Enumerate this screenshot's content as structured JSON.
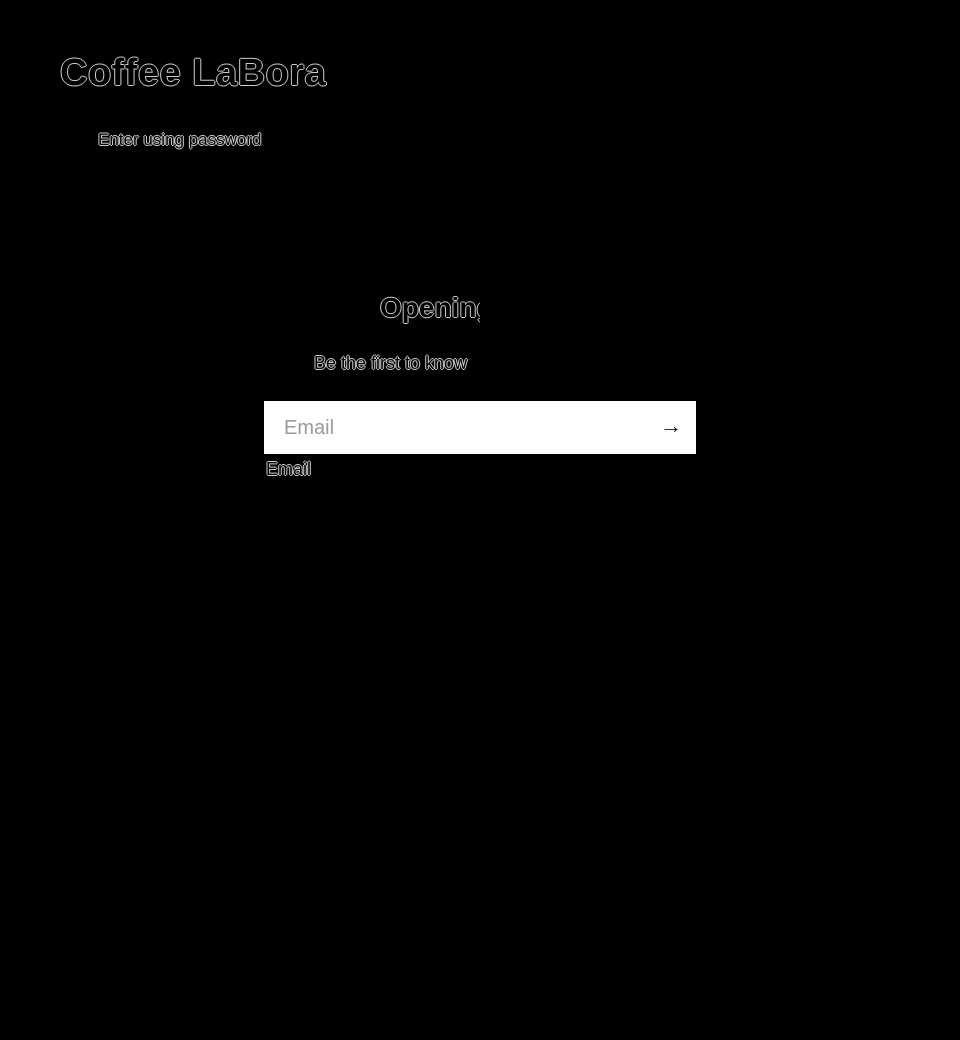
{
  "header": {
    "store_name": "Coffee LaBora",
    "enter_password_link": "Enter using password"
  },
  "main": {
    "heading": "Opening soon",
    "subheading": "Be the first to know",
    "email_placeholder": "Email",
    "email_value": "",
    "email_label": "Email",
    "submit_icon": "arrow-right-icon"
  }
}
